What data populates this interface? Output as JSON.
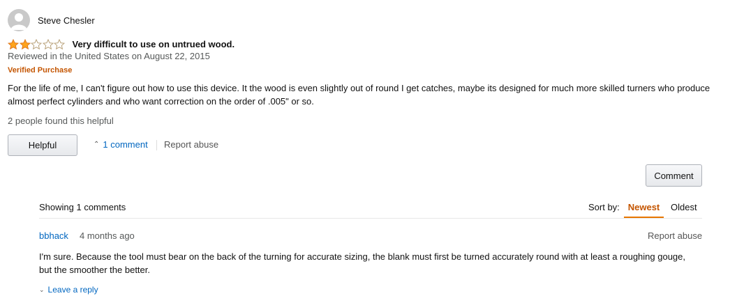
{
  "review": {
    "reviewer_name": "Steve Chesler",
    "rating": 2,
    "rating_max": 5,
    "title": "Very difficult to use on untrued wood.",
    "date": "Reviewed in the United States on August 22, 2015",
    "verified": "Verified Purchase",
    "body": "For the life of me, I can't figure out how to use this device. It the wood is even slightly out of round I get catches, maybe its designed for much more skilled turners who produce almost perfect cylinders and who want correction on the order of .005\" or so.",
    "helpful_count": "2 people found this helpful",
    "helpful_button": "Helpful",
    "comments_toggle": "1 comment",
    "report_abuse": "Report abuse"
  },
  "comments_section": {
    "comment_button": "Comment",
    "showing": "Showing 1 comments",
    "sort_label": "Sort by:",
    "sort_newest": "Newest",
    "sort_oldest": "Oldest",
    "comments": [
      {
        "author": "bbhack",
        "age": "4 months ago",
        "report_abuse": "Report abuse",
        "body": "I'm sure. Because the tool must bear on the back of the turning for accurate sizing, the blank must first be turned accurately round with at least a roughing gouge, but the smoother the better.",
        "reply": "Leave a reply"
      }
    ]
  },
  "colors": {
    "star_fill": "#ffa41c",
    "link": "#0066c0",
    "verified": "#c45500",
    "sort_active": "#c45500",
    "sort_underline": "#e77600"
  },
  "icons": {
    "avatar": "default-user-avatar-icon",
    "star_full": "star-filled-icon",
    "star_empty": "star-empty-icon",
    "caret_up": "caret-up-icon",
    "caret_down": "chevron-down-icon"
  }
}
